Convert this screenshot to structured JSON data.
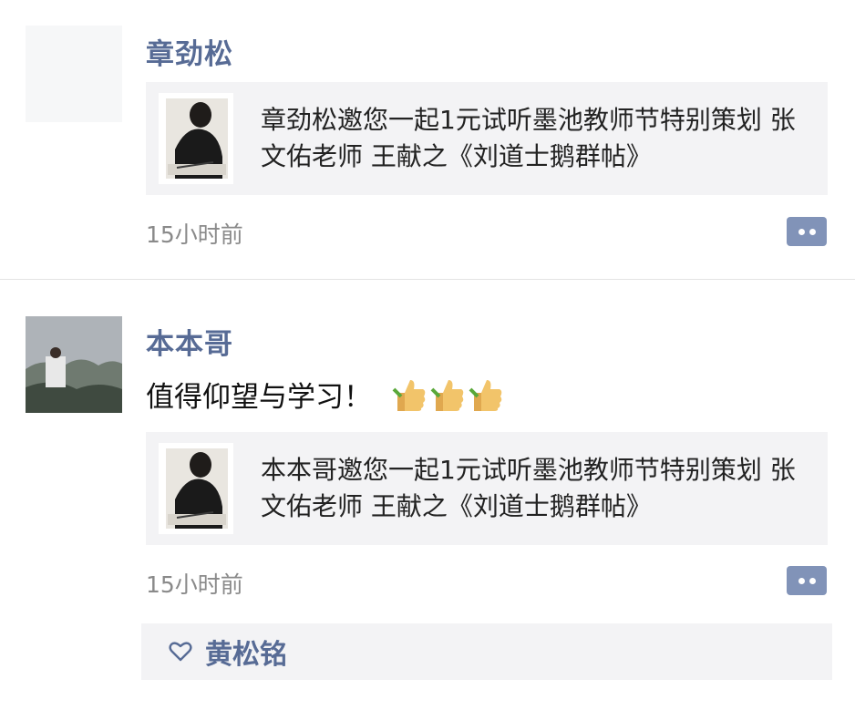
{
  "posts": [
    {
      "author": "章劲松",
      "text": "",
      "card_text": "章劲松邀您一起1元试听墨池教师节特别策划 张文佑老师 王献之《刘道士鹅群帖》",
      "time": "15小时前"
    },
    {
      "author": "本本哥",
      "text": "值得仰望与学习！",
      "card_text": "本本哥邀您一起1元试听墨池教师节特别策划 张文佑老师 王献之《刘道士鹅群帖》",
      "time": "15小时前",
      "likes": [
        "黄松铭"
      ]
    }
  ],
  "icons": {
    "comment": "comment-icon",
    "thumbs_up": "thumbs-up-icon",
    "heart": "heart-icon"
  },
  "colors": {
    "author": "#576b95",
    "comment_button": "#8193b8",
    "card_bg": "#f3f3f5"
  }
}
